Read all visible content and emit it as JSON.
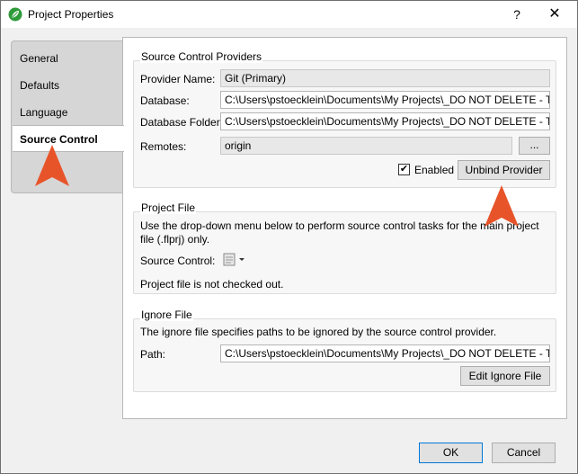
{
  "window": {
    "title": "Project Properties",
    "help_label": "?",
    "close_label": "✕"
  },
  "tabs": [
    {
      "label": "General"
    },
    {
      "label": "Defaults"
    },
    {
      "label": "Language"
    },
    {
      "label": "Source Control"
    }
  ],
  "providers": {
    "title": "Source Control Providers",
    "provider_name_label": "Provider Name:",
    "provider_name_value": "Git (Primary)",
    "database_label": "Database:",
    "database_value": "C:\\Users\\pstoecklein\\Documents\\My Projects\\_DO NOT DELETE - Test Branc",
    "database_folder_label": "Database Folder:",
    "database_folder_value": "C:\\Users\\pstoecklein\\Documents\\My Projects\\_DO NOT DELETE - Test Branc",
    "remotes_label": "Remotes:",
    "remotes_value": "origin",
    "browse_label": "...",
    "enabled_label": "Enabled",
    "enabled_checked": true,
    "unbind_label": "Unbind Provider"
  },
  "project_file": {
    "title": "Project File",
    "description": "Use the drop-down menu below to perform source control tasks for the main project file (.flprj) only.",
    "source_control_label": "Source Control:",
    "status_text": "Project file is not checked out."
  },
  "ignore_file": {
    "title": "Ignore File",
    "description": "The ignore file specifies paths to be ignored by the source control provider.",
    "path_label": "Path:",
    "path_value": "C:\\Users\\pstoecklein\\Documents\\My Projects\\_DO NOT DELETE - Test Branc",
    "edit_label": "Edit Ignore File"
  },
  "footer": {
    "ok_label": "OK",
    "cancel_label": "Cancel"
  },
  "colors": {
    "callout_arrow": "#e8542a",
    "app_icon": "#2e9a3a"
  }
}
